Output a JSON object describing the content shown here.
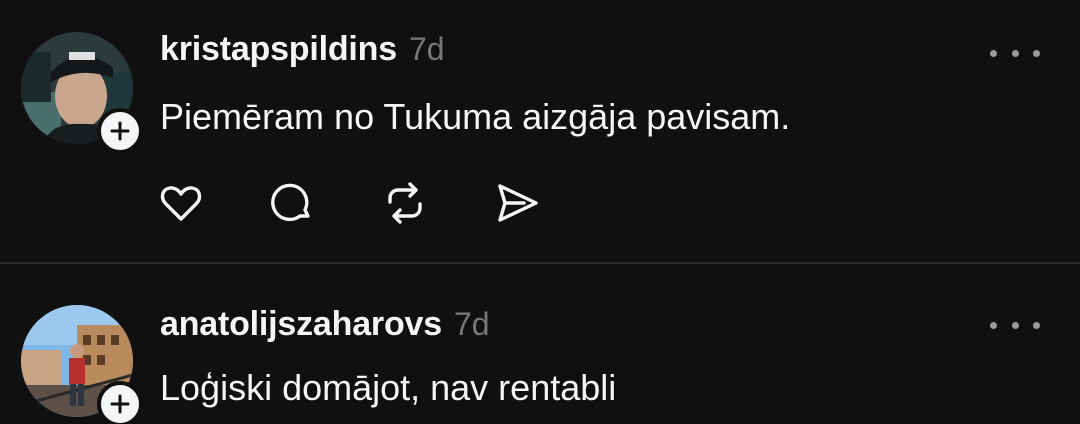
{
  "posts": [
    {
      "username": "kristapspildins",
      "time": "7d",
      "text": "Piemēram no Tukuma aizgāja pavisam."
    },
    {
      "username": "anatolijszaharovs",
      "time": "7d",
      "text": "Loģiski domājot, nav rentabli"
    }
  ],
  "icons": {
    "like": "heart-icon",
    "reply": "comment-icon",
    "repost": "repost-icon",
    "share": "send-icon",
    "more": "more-horizontal-icon",
    "follow": "plus-icon"
  },
  "colors": {
    "background": "#101010",
    "text_primary": "#f3f5f7",
    "text_secondary": "#777777",
    "divider": "#2a2a2a"
  }
}
